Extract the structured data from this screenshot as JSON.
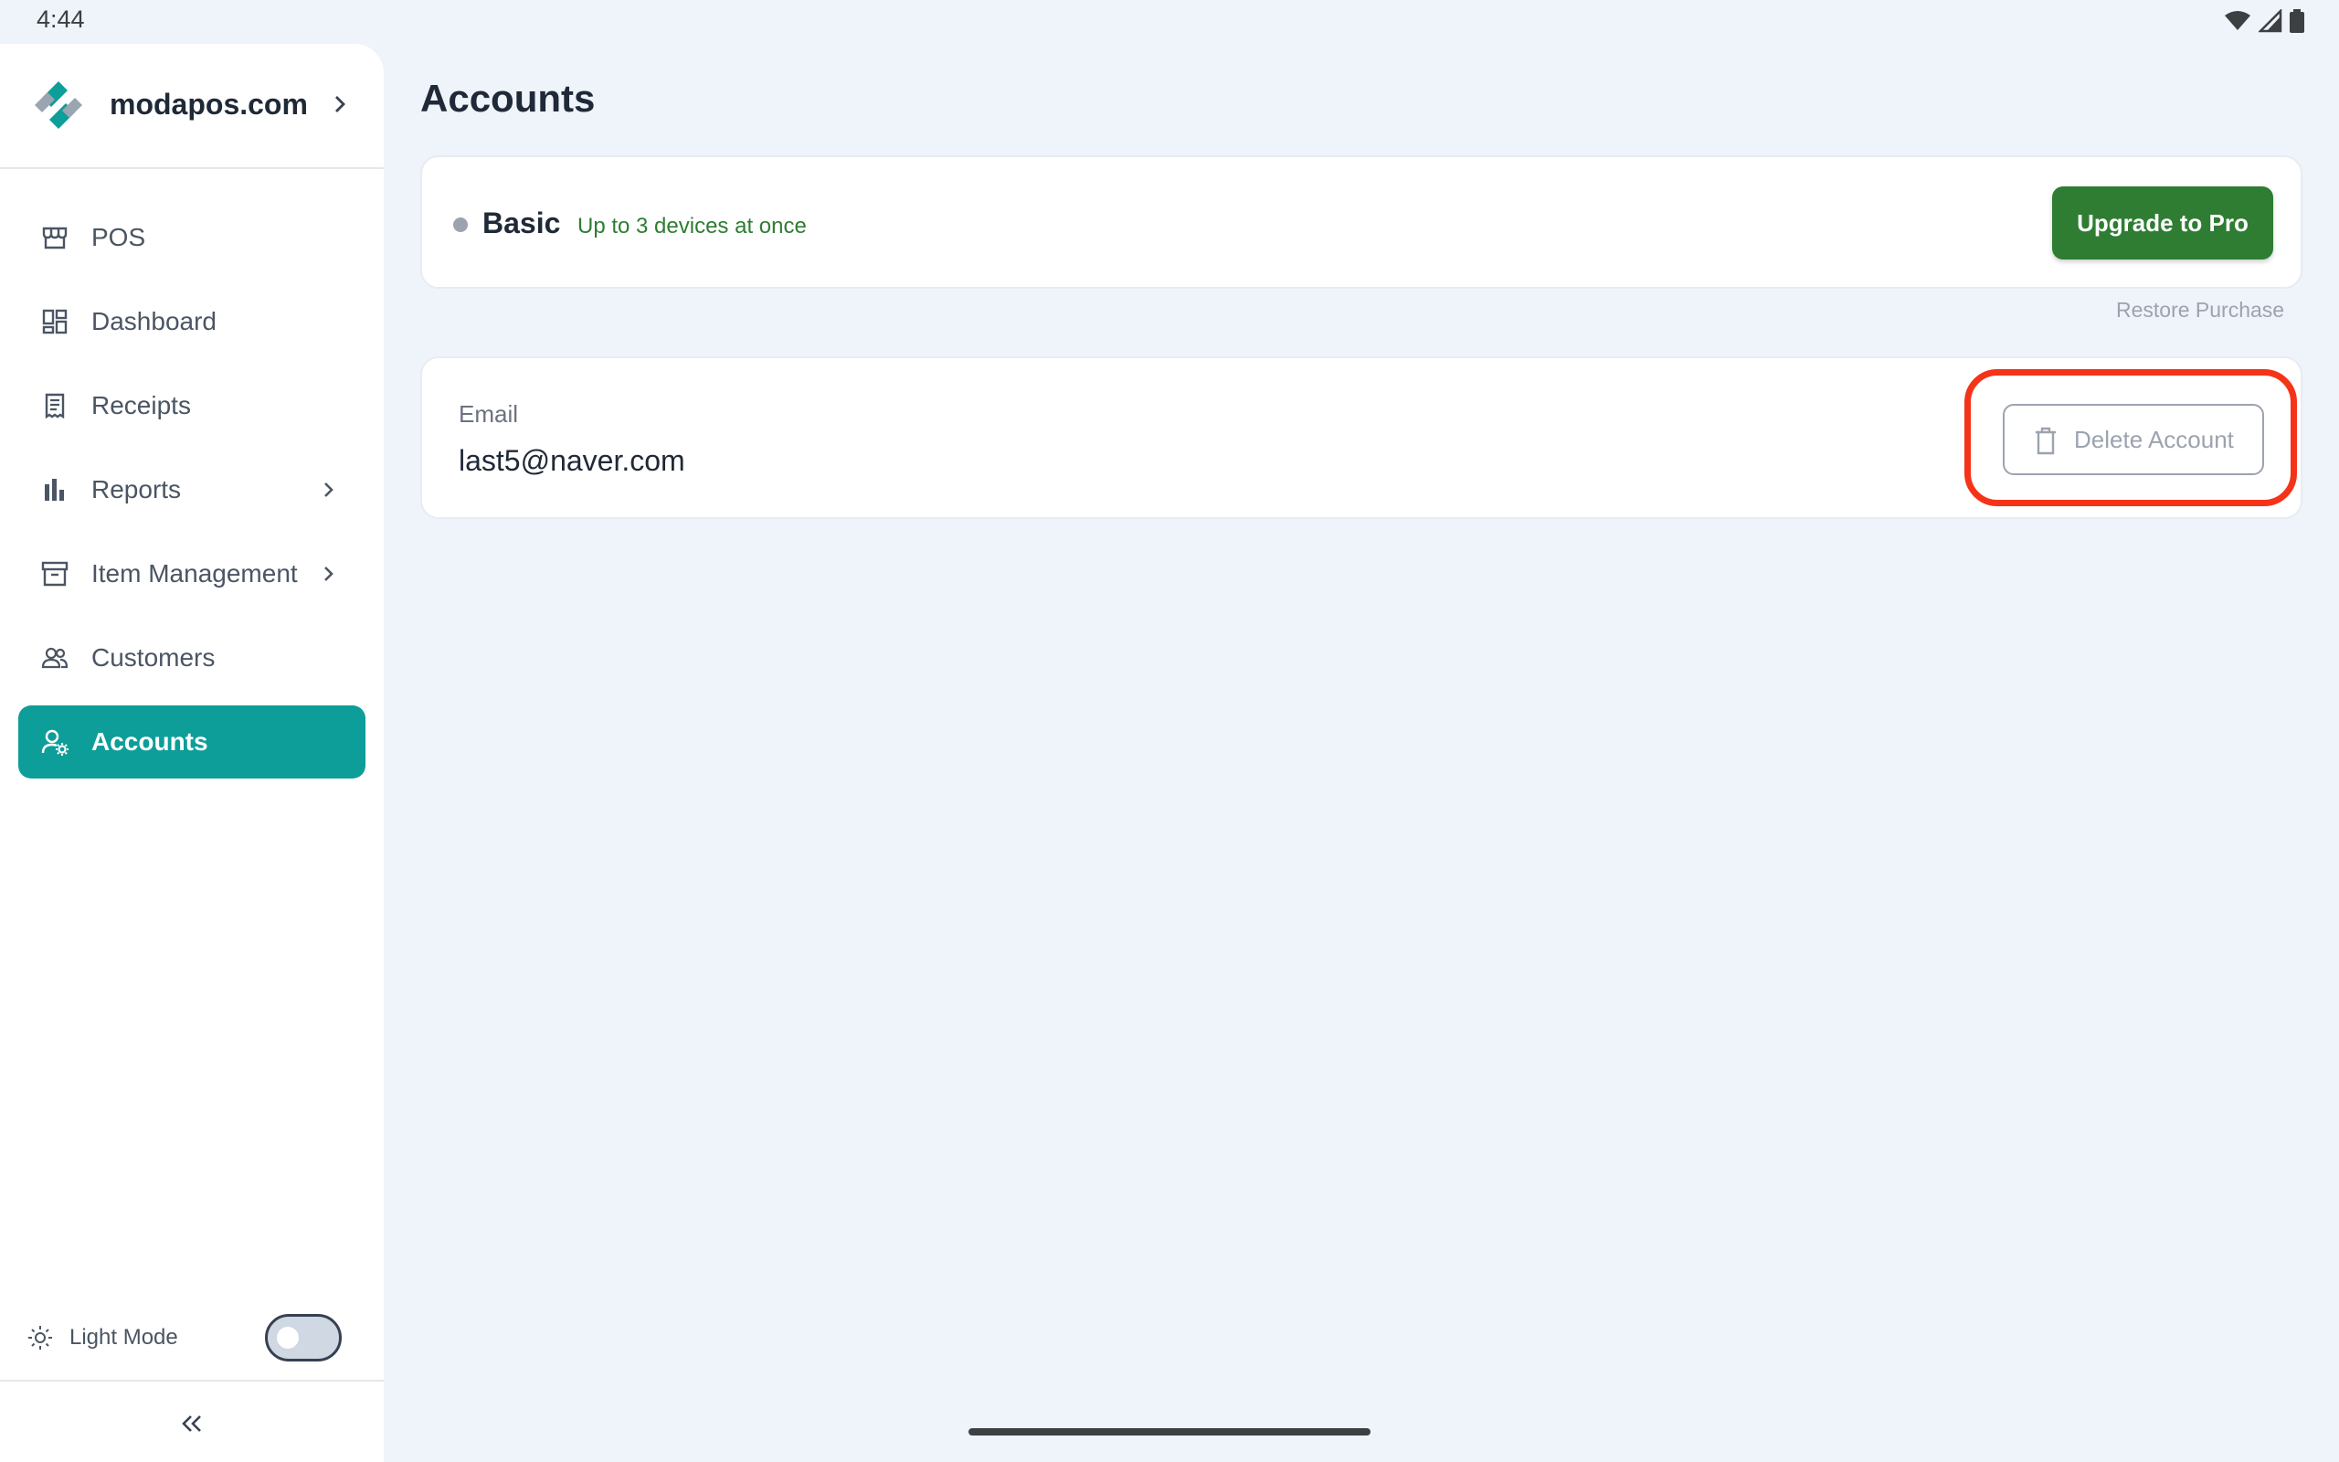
{
  "statusbar": {
    "time": "4:44"
  },
  "brand": {
    "name": "modapos.com"
  },
  "nav": [
    {
      "label": "POS",
      "icon": "store-icon"
    },
    {
      "label": "Dashboard",
      "icon": "dashboard-icon"
    },
    {
      "label": "Receipts",
      "icon": "receipt-icon"
    },
    {
      "label": "Reports",
      "icon": "bar-chart-icon",
      "has_submenu": true
    },
    {
      "label": "Item Management",
      "icon": "archive-icon",
      "has_submenu": true
    },
    {
      "label": "Customers",
      "icon": "users-icon"
    },
    {
      "label": "Accounts",
      "icon": "user-gear-icon",
      "active": true
    }
  ],
  "theme": {
    "label": "Light Mode"
  },
  "page": {
    "title": "Accounts"
  },
  "plan": {
    "name": "Basic",
    "description": "Up to 3 devices at once",
    "upgrade_label": "Upgrade to Pro",
    "restore_label": "Restore Purchase"
  },
  "account": {
    "email_label": "Email",
    "email_value": "last5@naver.com",
    "delete_label": "Delete Account"
  },
  "colors": {
    "accent": "#0d9e9a",
    "primary_green": "#2e7d32",
    "highlight_red": "#f53318"
  }
}
